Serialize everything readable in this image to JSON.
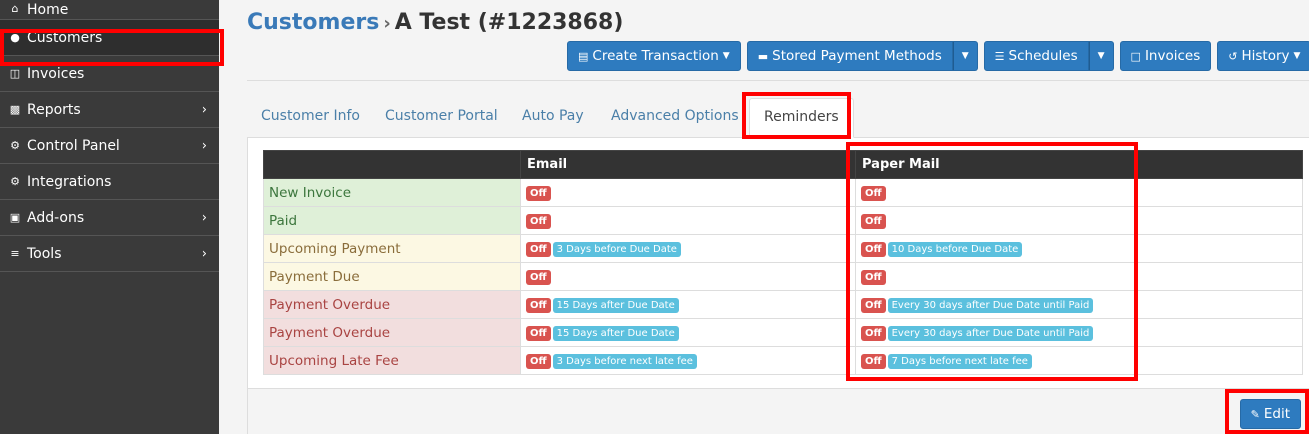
{
  "sidebar": {
    "items": [
      {
        "label": "Home",
        "icon": "home-icon",
        "chevron": false
      },
      {
        "label": "Customers",
        "icon": "users-icon",
        "chevron": false
      },
      {
        "label": "Invoices",
        "icon": "folder-icon",
        "chevron": false
      },
      {
        "label": "Reports",
        "icon": "bar-chart-icon",
        "chevron": true
      },
      {
        "label": "Control Panel",
        "icon": "gears-icon",
        "chevron": true
      },
      {
        "label": "Integrations",
        "icon": "gear-icon",
        "chevron": false
      },
      {
        "label": "Add-ons",
        "icon": "puzzle-icon",
        "chevron": true
      },
      {
        "label": "Tools",
        "icon": "sliders-icon",
        "chevron": true
      }
    ]
  },
  "header": {
    "breadcrumb": "Customers",
    "title": "A Test (#1223868)"
  },
  "toolbar": {
    "create_transaction": "Create Transaction",
    "stored_payment_methods": "Stored Payment Methods",
    "schedules": "Schedules",
    "invoices": "Invoices",
    "history": "History"
  },
  "tabs": [
    {
      "label": "Customer Info"
    },
    {
      "label": "Customer Portal"
    },
    {
      "label": "Auto Pay"
    },
    {
      "label": "Advanced Options"
    },
    {
      "label": "Reminders"
    }
  ],
  "table": {
    "headers": [
      "",
      "Email",
      "Paper Mail"
    ],
    "rows": [
      {
        "label": "New Invoice",
        "tone": "green",
        "email_status": "Off",
        "email_detail": "",
        "mail_status": "Off",
        "mail_detail": ""
      },
      {
        "label": "Paid",
        "tone": "green",
        "email_status": "Off",
        "email_detail": "",
        "mail_status": "Off",
        "mail_detail": ""
      },
      {
        "label": "Upcoming Payment",
        "tone": "yellow",
        "email_status": "Off",
        "email_detail": "3 Days before Due Date",
        "mail_status": "Off",
        "mail_detail": "10 Days before Due Date"
      },
      {
        "label": "Payment Due",
        "tone": "yellow",
        "email_status": "Off",
        "email_detail": "",
        "mail_status": "Off",
        "mail_detail": ""
      },
      {
        "label": "Payment Overdue",
        "tone": "red",
        "email_status": "Off",
        "email_detail": "15 Days after Due Date",
        "mail_status": "Off",
        "mail_detail": "Every 30 days after Due Date until Paid"
      },
      {
        "label": "Payment Overdue",
        "tone": "red",
        "email_status": "Off",
        "email_detail": "15 Days after Due Date",
        "mail_status": "Off",
        "mail_detail": "Every 30 days after Due Date until Paid"
      },
      {
        "label": "Upcoming Late Fee",
        "tone": "red",
        "email_status": "Off",
        "email_detail": "3 Days before next late fee",
        "mail_status": "Off",
        "mail_detail": "7 Days before next late fee"
      }
    ]
  },
  "footer": {
    "edit_label": "Edit"
  },
  "colors": {
    "primary": "#2e7bbf",
    "sidebar": "#3a3a3a",
    "off_badge": "#d9534f",
    "info_badge": "#5bc0de",
    "highlight": "#ff0000"
  }
}
